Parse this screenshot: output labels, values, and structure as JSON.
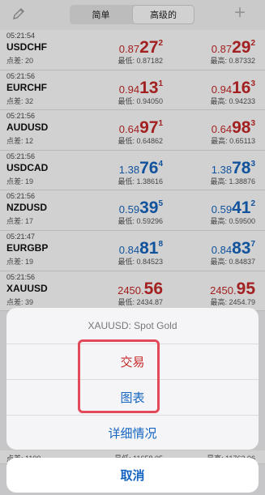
{
  "header": {
    "tabs": [
      "简单",
      "高级的"
    ],
    "active_tab": "高级的",
    "edit_icon": "pencil-icon",
    "add_icon": "plus-icon"
  },
  "quotes": [
    {
      "time": "05:21:54",
      "symbol": "USDCHF",
      "spread": "点差: 20",
      "bid": {
        "pre": "0.87",
        "big": "27",
        "sup": "2",
        "color": "red"
      },
      "ask": {
        "pre": "0.87",
        "big": "29",
        "sup": "2",
        "color": "red"
      },
      "low": "最低: 0.87182",
      "high": "最高: 0.87332"
    },
    {
      "time": "05:21:56",
      "symbol": "EURCHF",
      "spread": "点差: 32",
      "bid": {
        "pre": "0.94",
        "big": "13",
        "sup": "1",
        "color": "red"
      },
      "ask": {
        "pre": "0.94",
        "big": "16",
        "sup": "3",
        "color": "red"
      },
      "low": "最低: 0.94050",
      "high": "最高: 0.94233"
    },
    {
      "time": "05:21:56",
      "symbol": "AUDUSD",
      "spread": "点差: 12",
      "bid": {
        "pre": "0.64",
        "big": "97",
        "sup": "1",
        "color": "red"
      },
      "ask": {
        "pre": "0.64",
        "big": "98",
        "sup": "3",
        "color": "red"
      },
      "low": "最低: 0.64862",
      "high": "最高: 0.65113"
    },
    {
      "time": "05:21:56",
      "symbol": "USDCAD",
      "spread": "点差: 19",
      "bid": {
        "pre": "1.38",
        "big": "76",
        "sup": "4",
        "color": "blue"
      },
      "ask": {
        "pre": "1.38",
        "big": "78",
        "sup": "3",
        "color": "blue"
      },
      "low": "最低: 1.38616",
      "high": "最高: 1.38876"
    },
    {
      "time": "05:21:56",
      "symbol": "NZDUSD",
      "spread": "点差: 17",
      "bid": {
        "pre": "0.59",
        "big": "39",
        "sup": "5",
        "color": "blue"
      },
      "ask": {
        "pre": "0.59",
        "big": "41",
        "sup": "2",
        "color": "blue"
      },
      "low": "最低: 0.59296",
      "high": "最高: 0.59500"
    },
    {
      "time": "05:21:47",
      "symbol": "EURGBP",
      "spread": "点差: 19",
      "bid": {
        "pre": "0.84",
        "big": "81",
        "sup": "8",
        "color": "blue"
      },
      "ask": {
        "pre": "0.84",
        "big": "83",
        "sup": "7",
        "color": "blue"
      },
      "low": "最低: 0.84523",
      "high": "最高: 0.84837"
    },
    {
      "time": "05:21:56",
      "symbol": "XAUUSD",
      "spread": "点差: 39",
      "bid": {
        "pre": "2450.",
        "big": "56",
        "sup": "",
        "color": "red"
      },
      "ask": {
        "pre": "2450.",
        "big": "95",
        "sup": "",
        "color": "red"
      },
      "low": "最低: 2434.87",
      "high": "最高: 2454.79"
    }
  ],
  "partial_row": {
    "spread": "点差: 1100",
    "low": "最低: 11658.05",
    "high": "最高: 11763.06"
  },
  "action_sheet": {
    "title": "XAUUSD: Spot Gold",
    "items": [
      "交易",
      "图表",
      "详细情况"
    ],
    "cancel": "取消"
  }
}
